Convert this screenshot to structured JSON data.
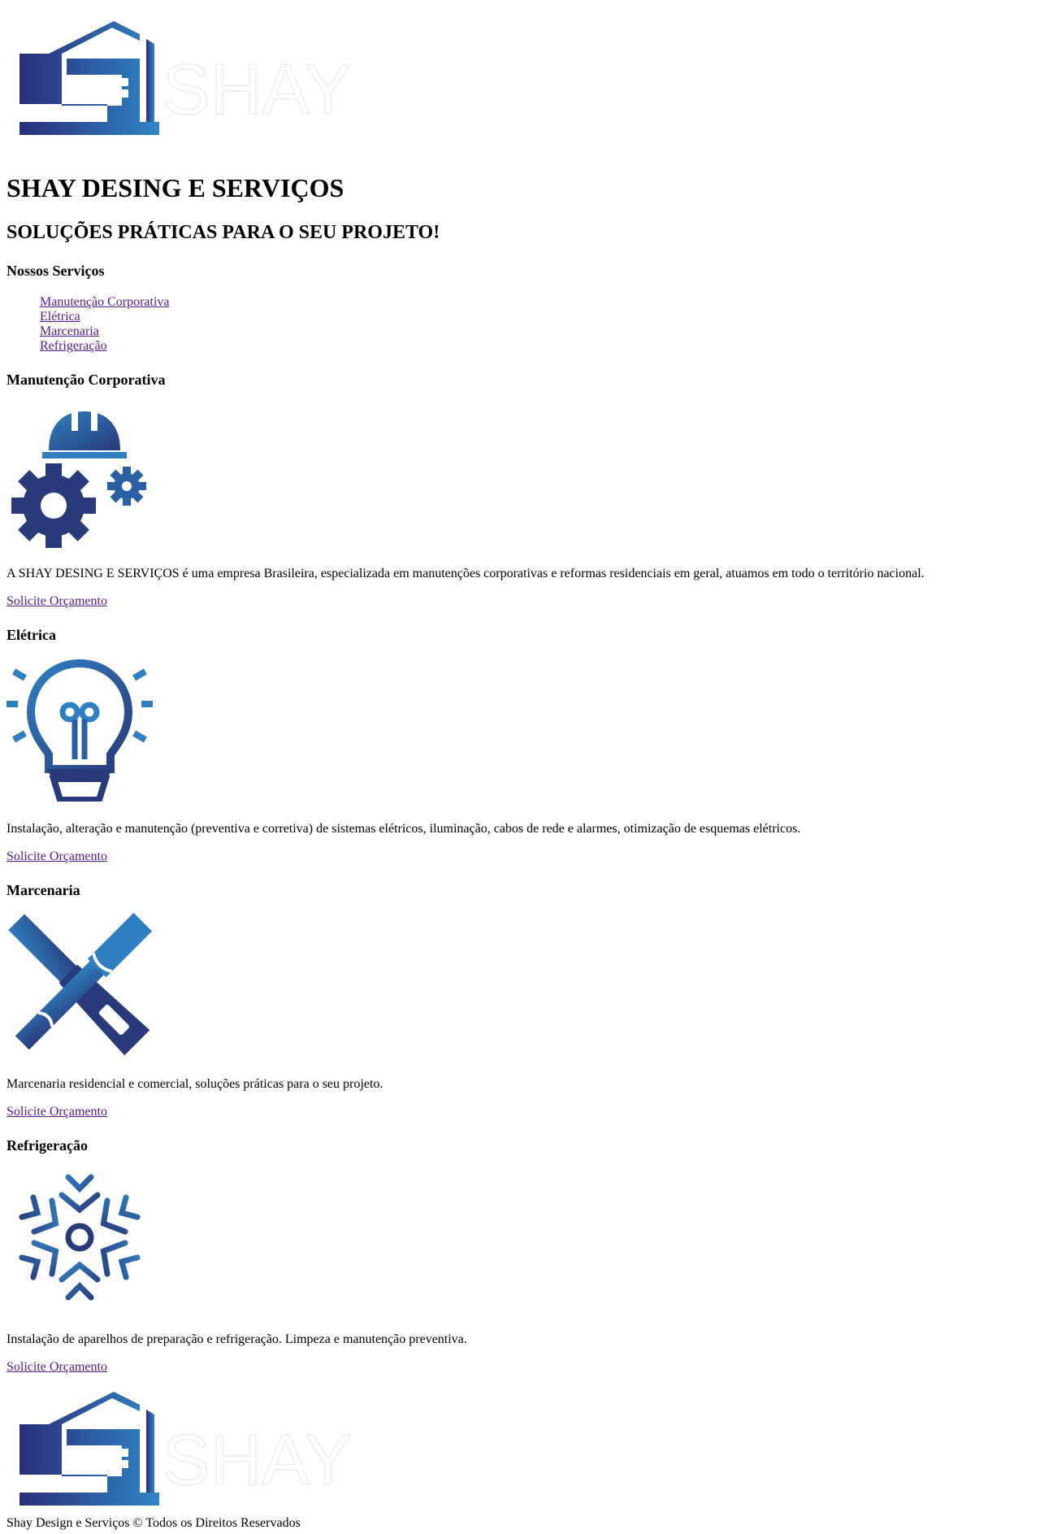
{
  "header": {
    "logo_alt": "SHAY",
    "title": "SHAY DESING E SERVIÇOS",
    "subtitle": "SOLUÇÕES PRÁTICAS PARA O SEU PROJETO!"
  },
  "services_nav": {
    "heading": "Nossos Serviços",
    "items": [
      {
        "label": "Manutenção Corporativa"
      },
      {
        "label": "Elétrica"
      },
      {
        "label": "Marcenaria"
      },
      {
        "label": "Refrigeração"
      }
    ]
  },
  "services": [
    {
      "title": "Manutenção Corporativa",
      "icon": "gears-helmet-icon",
      "description": "A SHAY DESING E SERVIÇOS é uma empresa Brasileira, especializada em manutenções corporativas e reformas residenciais em geral, atuamos em todo o território nacional.",
      "cta": "Solicite Orçamento"
    },
    {
      "title": "Elétrica",
      "icon": "light-bulb-icon",
      "description": "Instalação, alteração e manutenção (preventiva e corretiva) de sistemas elétricos, iluminação, cabos de rede e alarmes, otimização de esquemas elétricos.",
      "cta": "Solicite Orçamento"
    },
    {
      "title": "Marcenaria",
      "icon": "crossed-tools-icon",
      "description": "Marcenaria residencial e comercial, soluções práticas para o seu projeto.",
      "cta": "Solicite Orçamento"
    },
    {
      "title": "Refrigeração",
      "icon": "snowflake-icon",
      "description": "Instalação de aparelhos de preparação e refrigeração. Limpeza e manutenção preventiva.",
      "cta": "Solicite Orçamento"
    }
  ],
  "footer": {
    "logo_alt": "SHAY",
    "copyright": "Shay Design e Serviços © Todos os Direitos Reservados"
  },
  "colors": {
    "brand_dark": "#283a7a",
    "brand_light": "#2f7fc0",
    "link": "#551a8b"
  }
}
